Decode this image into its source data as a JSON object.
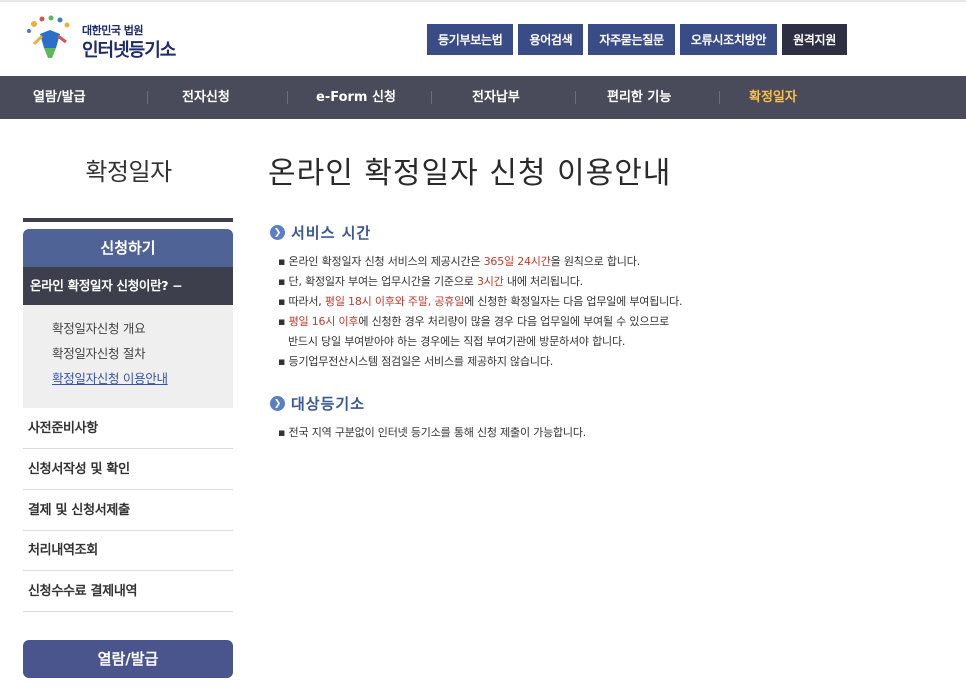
{
  "header": {
    "logo_small": "대한민국 법원",
    "logo_big": "인터넷등기소",
    "utility_buttons": [
      "등기부보는법",
      "용어검색",
      "자주묻는질문",
      "오류시조치방안",
      "원격지원"
    ]
  },
  "gnb": {
    "items": [
      "열람/발급",
      "전자신청",
      "e-Form 신청",
      "전자납부",
      "편리한 기능",
      "확정일자"
    ],
    "active_index": 5,
    "active_color": "#f5c04d"
  },
  "lnb": {
    "title": "확정일자",
    "apply_label": "신청하기",
    "current_menu": "온라인 확정일자 신청이란? −",
    "sub_items": [
      "확정일자신청 개요",
      "확정일자신청 절차",
      "확정일자신청 이용안내"
    ],
    "menus": [
      "사전준비사항",
      "신청서작성 및 확인",
      "결제 및 신청서제출",
      "처리내역조회",
      "신청수수료 결제내역"
    ],
    "view_label": "열람/발급"
  },
  "content": {
    "page_title": "온라인 확정일자 신청 이용안내",
    "service_time": {
      "heading": "서비스 시간",
      "line1": {
        "a": "▪ 온라인 확정일자 신청 서비스의 제공시간은 ",
        "b": "365일 24시간",
        "c": "을 원칙으로 합니다."
      },
      "line2": {
        "a": "▪ 단, 확정일자 부여는 업무시간을 기준으로 ",
        "b": "3시간",
        "c": " 내에 처리됩니다."
      },
      "line3": {
        "a": "▪ 따라서, ",
        "b": "평일 18시 이후와 주말, 공휴일",
        "c": "에 신청한 확정일자는 다음 업무일에 부여됩니다."
      },
      "line4": {
        "a": "▪ ",
        "b": "평일 16시 이후",
        "c": "에 신청한 경우 처리량이 많을 경우 다음 업무일에 부여될 수 있으므로"
      },
      "line5": "반드시 당일 부여받아야 하는 경우에는 직접 부여기관에 방문하셔야 합니다.",
      "line6": "▪ 등기업무전산시스템 점검일은 서비스를 제공하지 않습니다."
    },
    "target": {
      "heading": "대상등기소",
      "line1": "▪ 전국 지역 구분없이 인터넷 등기소를 통해 신청 제출이 가능합니다."
    }
  },
  "colors": {
    "gnb_bg": "#4a4b5a",
    "util_bg": "#3a4c86",
    "highlight": "#c0392b",
    "lnb_apply": "#4f6397"
  }
}
